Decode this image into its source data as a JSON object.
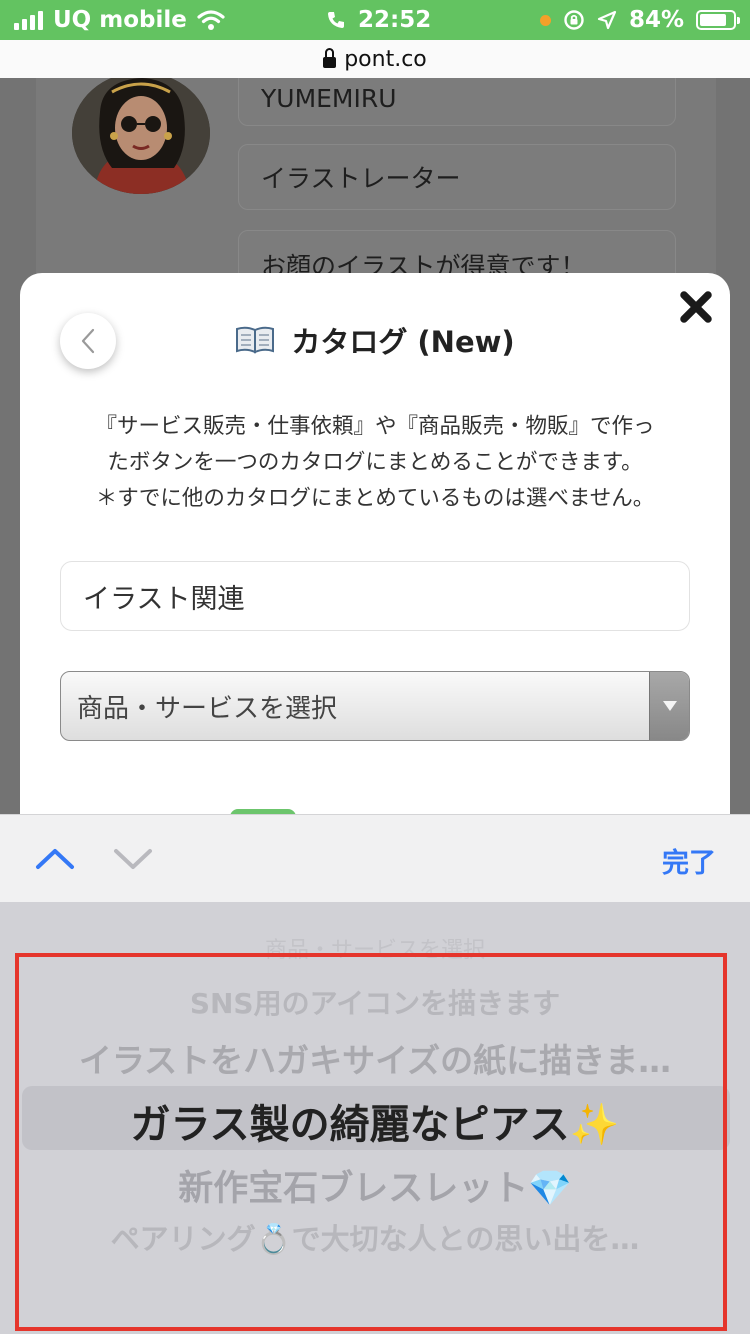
{
  "status_bar": {
    "carrier": "UQ mobile",
    "time": "22:52",
    "battery_percent": "84%",
    "bar_color": "#63c361"
  },
  "browser": {
    "domain": "pont.co"
  },
  "background_profile": {
    "name": "YUMEMIRU",
    "job": "イラストレーター",
    "bio": "お顔のイラストが得意です！"
  },
  "modal": {
    "title": "カタログ (New)",
    "title_icon": "open-book-icon",
    "description_lines": [
      "『サービス販売・仕事依頼』や『商品販売・物販』で作っ",
      "たボタンを一つのカタログにまとめることができます。",
      "＊すでに他のカタログにまとめているものは選べません。"
    ],
    "catalog_name_value": "イラスト関連",
    "select_label": "商品・サービスを選択"
  },
  "keyboard_accessory": {
    "done_label": "完了",
    "accent_color": "#3478f6"
  },
  "picker": {
    "ghost_label": "商品・サービスを選択",
    "options": [
      "SNS用のアイコンを描きます",
      "イラストをハガキサイズの紙に描きま…",
      "ガラス製の綺麗なピアス✨",
      "新作宝石ブレスレット💎",
      "ペアリング💍で大切な人との思い出を…"
    ],
    "selected_option": "ガラス製の綺麗なピアス✨",
    "highlight_frame_color": "#e5352c"
  }
}
